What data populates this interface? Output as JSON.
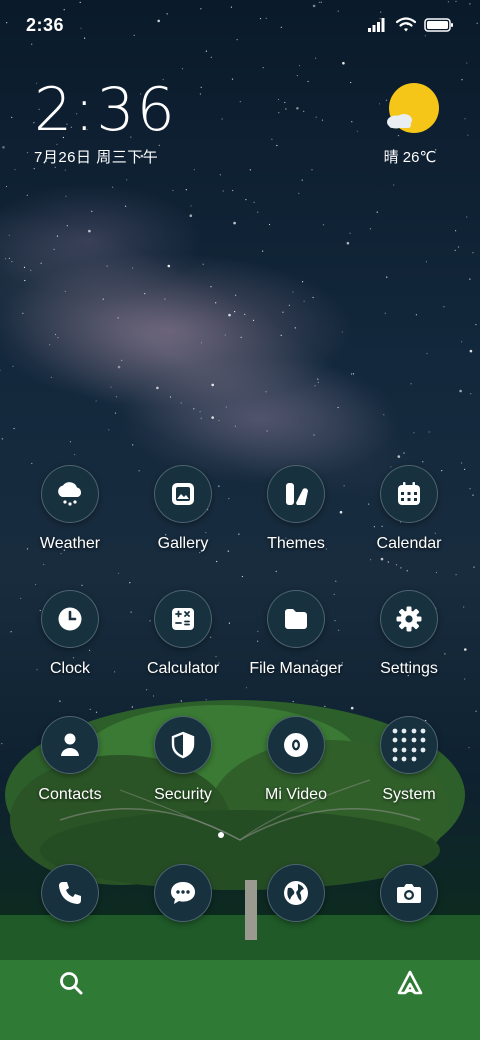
{
  "status_bar": {
    "time": "2:36",
    "icons": [
      "signal-icon",
      "wifi-icon",
      "battery-icon"
    ]
  },
  "clock_widget": {
    "time": "2:36",
    "date": "7月26日 周三下午"
  },
  "weather_widget": {
    "icon": "sun-cloud-icon",
    "text": "晴 26℃"
  },
  "apps": [
    {
      "label": "Weather",
      "icon": "cloud-rain-icon"
    },
    {
      "label": "Gallery",
      "icon": "gallery-icon"
    },
    {
      "label": "Themes",
      "icon": "themes-icon"
    },
    {
      "label": "Calendar",
      "icon": "calendar-icon"
    },
    {
      "label": "Clock",
      "icon": "clock-icon"
    },
    {
      "label": "Calculator",
      "icon": "calculator-icon"
    },
    {
      "label": "File Manager",
      "icon": "folder-icon"
    },
    {
      "label": "Settings",
      "icon": "gear-icon"
    },
    {
      "label": "Contacts",
      "icon": "person-icon"
    },
    {
      "label": "Security",
      "icon": "shield-icon"
    },
    {
      "label": "Mi Video",
      "icon": "video-icon"
    },
    {
      "label": "System",
      "icon": "folder-grid-icon"
    }
  ],
  "dock": [
    {
      "name": "phone",
      "icon": "phone-icon"
    },
    {
      "name": "messages",
      "icon": "message-icon"
    },
    {
      "name": "browser",
      "icon": "globe-icon"
    },
    {
      "name": "camera",
      "icon": "camera-icon"
    }
  ],
  "bottom_bar": [
    "search-icon",
    "assistant-icon"
  ],
  "colors": {
    "icon_bg": "#17313f",
    "sun": "#f5c518"
  }
}
